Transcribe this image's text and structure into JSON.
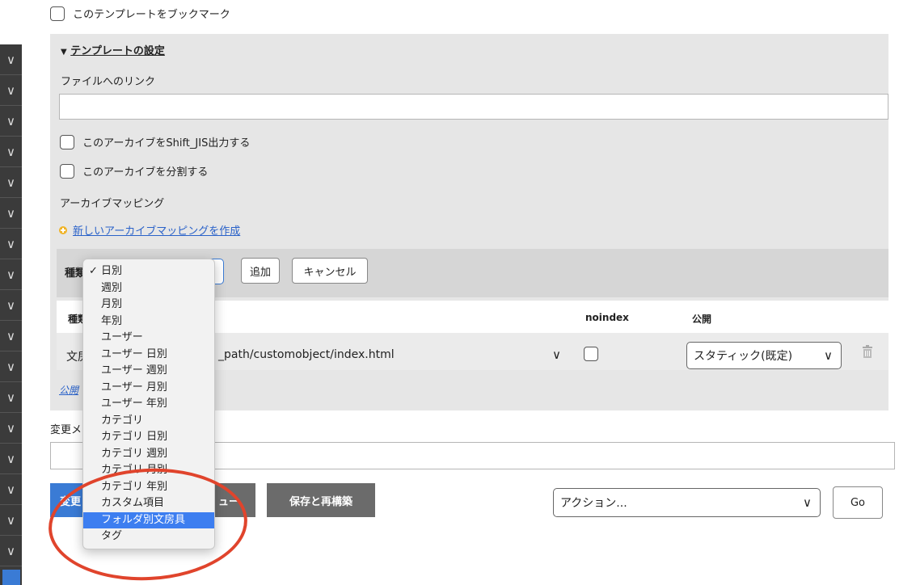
{
  "bookmark": {
    "label": "このテンプレートをブックマーク"
  },
  "template_settings": {
    "title": "テンプレートの設定",
    "title_arrow": "▼",
    "file_link_label": "ファイルへのリンク",
    "file_link_value": "",
    "shift_jis_label": "このアーカイブをShift_JIS出力する",
    "split_label": "このアーカイブを分割する",
    "archive_mapping_label": "アーカイブマッピング",
    "new_mapping_link": "新しいアーカイブマッピングを作成"
  },
  "mapping_form": {
    "type_label": "種類",
    "add_button": "追加",
    "cancel_button": "キャンセル"
  },
  "mapping_table": {
    "headers": {
      "type": "種類",
      "noindex": "noindex",
      "publish": "公開"
    },
    "row": {
      "type": "文房",
      "path": "_path/customobject/index.html",
      "publish": "スタティック(既定)"
    },
    "footer_link": "公開"
  },
  "change_memo": {
    "label": "変更メ",
    "value": ""
  },
  "buttons": {
    "save_label": "変更",
    "preview_label": "ュー",
    "save_rebuild_label": "保存と再構築",
    "action_select": "アクション...",
    "go_label": "Go"
  },
  "dropdown": {
    "options": [
      "日別",
      "週別",
      "月別",
      "年別",
      "ユーザー",
      "ユーザー 日別",
      "ユーザー 週別",
      "ユーザー 月別",
      "ユーザー 年別",
      "カテゴリ",
      "カテゴリ 日別",
      "カテゴリ 週別",
      "カテゴリ 月別",
      "カテゴリ 年別",
      "カスタム項目",
      "フォルダ別文房具",
      "タグ"
    ],
    "checked_index": 0,
    "highlighted_index": 15,
    "check_mark": "✓"
  },
  "colors": {
    "primary_button": "#3a7bd5",
    "secondary_button": "#6b6b6b",
    "link": "#2a62c9",
    "highlight": "#3d7ef0",
    "annotation": "#e0442c"
  }
}
